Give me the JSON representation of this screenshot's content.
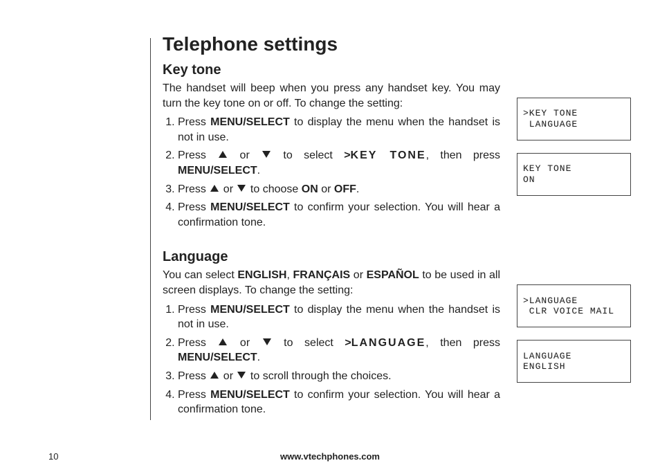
{
  "title": "Telephone settings",
  "sections": {
    "keytone": {
      "heading": "Key tone",
      "intro_a": "The handset will beep when you press any handset key. You may turn the key tone on or off. To change the setting:",
      "step1_a": "Press ",
      "step1_b": " to display the menu when the handset is not in use.",
      "step2_a": "Press ",
      "step2_b": " or ",
      "step2_c": " to select ",
      "step2_d": ">",
      "step2_key": "KEY TONE",
      "step2_e": ", then press ",
      "step3_a": "Press ",
      "step3_b": " or ",
      "step3_c": " to choose ",
      "step3_on": "ON",
      "step3_or": " or ",
      "step3_off": "OFF",
      "step3_d": ".",
      "step4_a": "Press ",
      "step4_b": " to confirm your selection. You will hear a confirmation tone."
    },
    "language": {
      "heading": "Language",
      "intro_a": "You can select ",
      "intro_en": "ENGLISH",
      "intro_comma1": ", ",
      "intro_fr": "FRANÇAIS",
      "intro_or": " or ",
      "intro_es": "ESPAÑOL",
      "intro_b": " to be used in all screen displays. To change the setting:",
      "step1_a": "Press ",
      "step1_b": " to display the menu when the handset is not in use.",
      "step2_a": "Press ",
      "step2_b": " or ",
      "step2_c": " to select ",
      "step2_d": ">",
      "step2_key": "LANGUAGE",
      "step2_e": ", then press ",
      "step3_a": "Press ",
      "step3_b": " or ",
      "step3_c": " to scroll through the choices.",
      "step4_a": "Press ",
      "step4_b": " to confirm your selection. You will hear a confirmation tone."
    }
  },
  "common": {
    "menu_select": "MENU/SELECT",
    "period": "."
  },
  "lcd": {
    "keytone_menu": {
      "l1": ">KEY TONE",
      "l2": " LANGUAGE"
    },
    "keytone_val": {
      "l1": "KEY TONE",
      "l2": "ON"
    },
    "lang_menu": {
      "l1": ">LANGUAGE",
      "l2": " CLR VOICE MAIL"
    },
    "lang_val": {
      "l1": "LANGUAGE",
      "l2": "ENGLISH"
    }
  },
  "footer": {
    "page": "10",
    "url": "www.vtechphones.com"
  }
}
